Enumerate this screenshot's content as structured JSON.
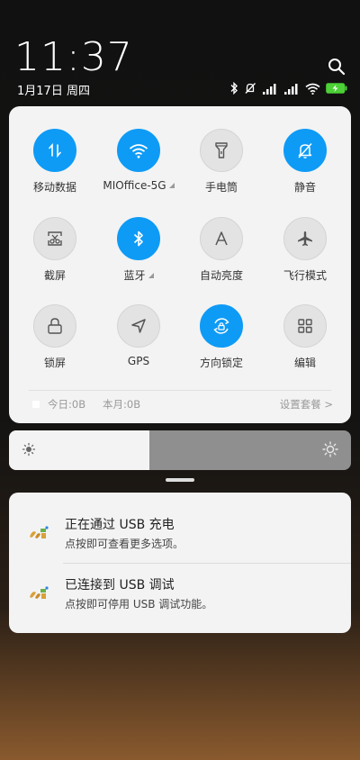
{
  "status": {
    "time": "11:37",
    "date": "1月17日 周四"
  },
  "tiles": [
    {
      "label": "移动数据",
      "on": true,
      "icon": "mobile-data-icon"
    },
    {
      "label": "MIOffice-5G",
      "on": true,
      "icon": "wifi-icon",
      "expandable": true
    },
    {
      "label": "手电筒",
      "on": false,
      "icon": "flashlight-icon"
    },
    {
      "label": "静音",
      "on": true,
      "icon": "mute-bell-icon"
    },
    {
      "label": "截屏",
      "on": false,
      "icon": "screenshot-icon"
    },
    {
      "label": "蓝牙",
      "on": true,
      "icon": "bluetooth-icon",
      "expandable": true
    },
    {
      "label": "自动亮度",
      "on": false,
      "icon": "auto-brightness-icon"
    },
    {
      "label": "飞行模式",
      "on": false,
      "icon": "airplane-icon"
    },
    {
      "label": "锁屏",
      "on": false,
      "icon": "lock-icon"
    },
    {
      "label": "GPS",
      "on": false,
      "icon": "gps-icon"
    },
    {
      "label": "方向锁定",
      "on": true,
      "icon": "rotation-lock-icon"
    },
    {
      "label": "编辑",
      "on": false,
      "icon": "edit-grid-icon"
    }
  ],
  "data_usage": {
    "today": "今日:0B",
    "month": "本月:0B",
    "settings": "设置套餐 >"
  },
  "brightness": {
    "level": 0.41
  },
  "notifications": [
    {
      "title": "正在通过 USB 充电",
      "body": "点按即可查看更多选项。",
      "icon": "app-icon"
    },
    {
      "title": "已连接到 USB 调试",
      "body": "点按即可停用 USB 调试功能。",
      "icon": "app-icon"
    }
  ],
  "colors": {
    "accent": "#0e9bf6",
    "battery": "#4cd137"
  }
}
